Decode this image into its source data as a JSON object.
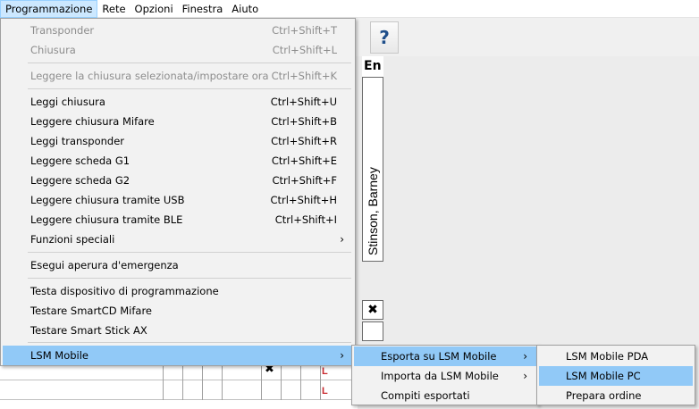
{
  "menubar": [
    "Programmazione",
    "Rete",
    "Opzioni",
    "Finestra",
    "Aiuto"
  ],
  "toolbar": {
    "help_glyph": "?",
    "red_glyph": "✱"
  },
  "grid": {
    "header": "En",
    "person": "Stinson, Barney",
    "x_glyph": "✖",
    "l_glyph": "L"
  },
  "programming_menu": {
    "groups": [
      [
        {
          "label": "Transponder",
          "shortcut": "Ctrl+Shift+T",
          "disabled": true
        },
        {
          "label": "Chiusura",
          "shortcut": "Ctrl+Shift+L",
          "disabled": true
        }
      ],
      [
        {
          "label": "Leggere la chiusura selezionata/impostare ora",
          "shortcut": "Ctrl+Shift+K",
          "disabled": true
        }
      ],
      [
        {
          "label": "Leggi chiusura",
          "shortcut": "Ctrl+Shift+U"
        },
        {
          "label": "Leggere chiusura Mifare",
          "shortcut": "Ctrl+Shift+B"
        },
        {
          "label": "Leggi transponder",
          "shortcut": "Ctrl+Shift+R"
        },
        {
          "label": "Leggere scheda G1",
          "shortcut": "Ctrl+Shift+E"
        },
        {
          "label": "Leggere scheda G2",
          "shortcut": "Ctrl+Shift+F"
        },
        {
          "label": "Leggere chiusura tramite USB",
          "shortcut": "Ctrl+Shift+H"
        },
        {
          "label": "Leggere chiusura tramite BLE",
          "shortcut": "Ctrl+Shift+I"
        },
        {
          "label": "Funzioni speciali",
          "submenu": true
        }
      ],
      [
        {
          "label": "Esegui aperura d'emergenza"
        }
      ],
      [
        {
          "label": "Testa dispositivo di programmazione"
        },
        {
          "label": "Testare SmartCD Mifare"
        },
        {
          "label": "Testare Smart Stick AX"
        }
      ],
      [
        {
          "label": "LSM Mobile",
          "submenu": true,
          "highlighted": true
        }
      ]
    ]
  },
  "lsm_mobile_menu": [
    {
      "label": "Esporta su LSM Mobile",
      "submenu": true,
      "highlighted": true
    },
    {
      "label": "Importa da LSM Mobile",
      "submenu": true
    },
    {
      "label": "Compiti esportati"
    }
  ],
  "export_menu": [
    {
      "label": "LSM Mobile PDA"
    },
    {
      "label": "LSM Mobile PC",
      "highlighted": true
    },
    {
      "label": "Prepara ordine"
    }
  ]
}
